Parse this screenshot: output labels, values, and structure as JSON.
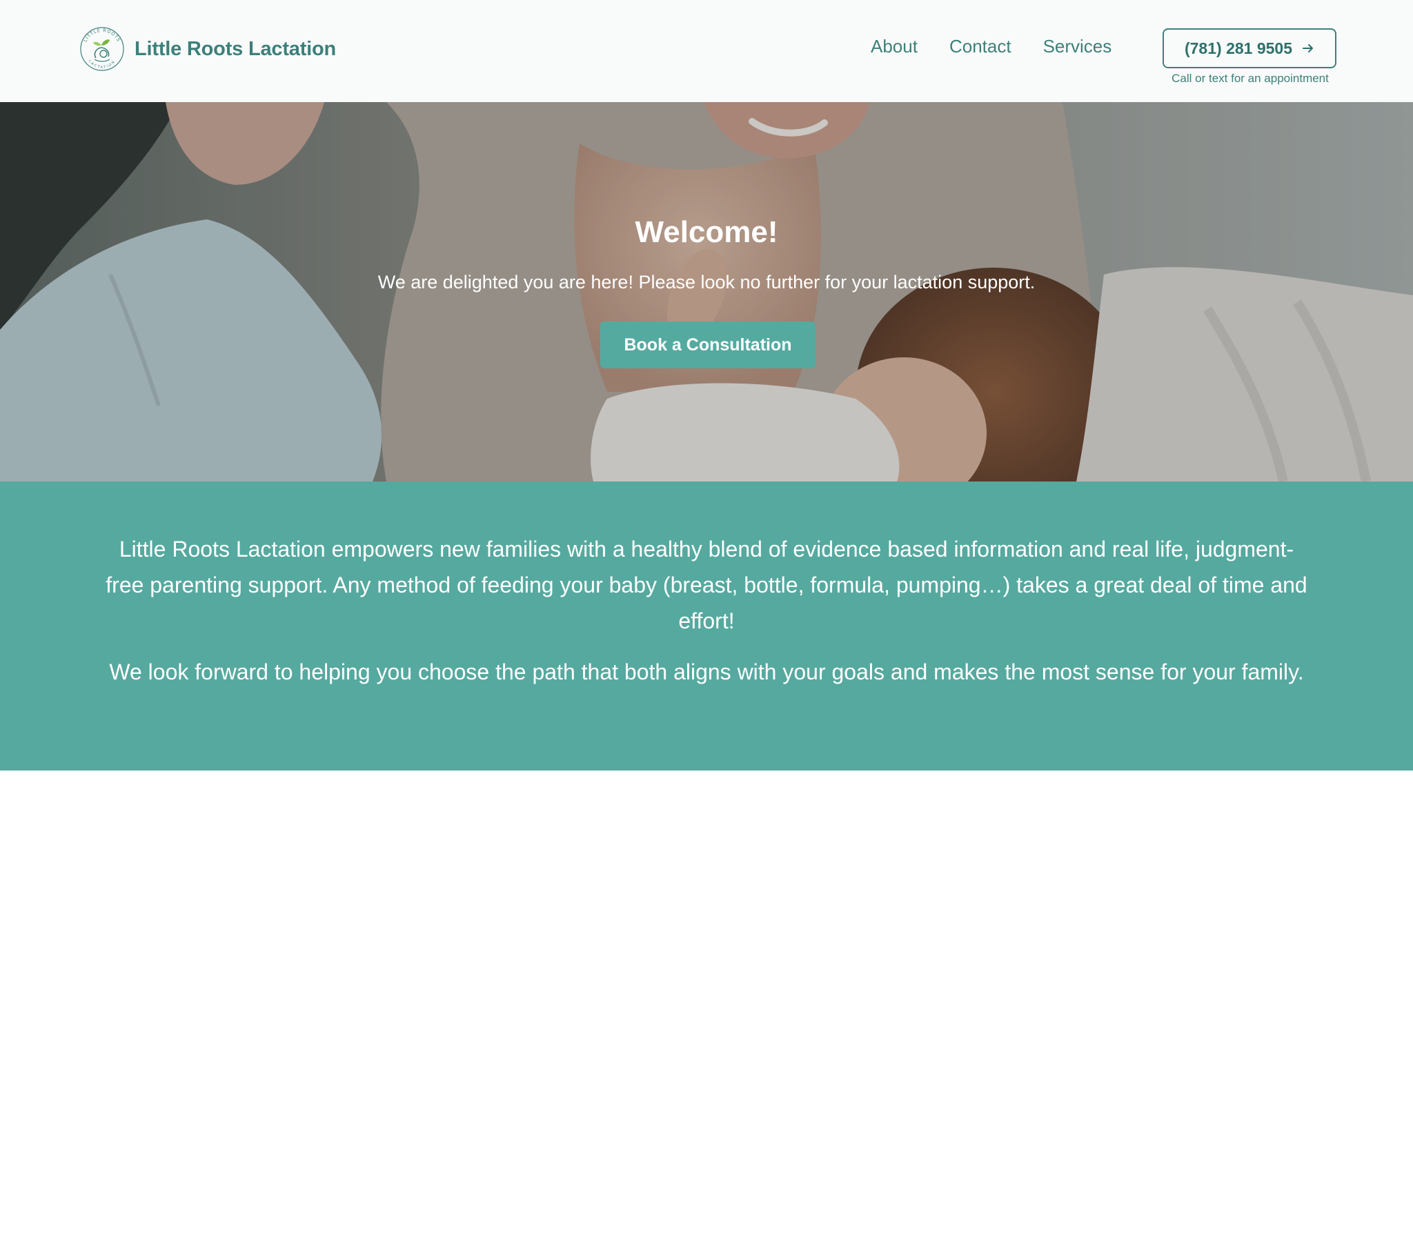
{
  "brand": {
    "name": "Little Roots Lactation",
    "logo_icon": "little-roots-logo-icon",
    "logo_text": "LITTLE ROOTS LACTATION"
  },
  "nav": {
    "items": [
      {
        "label": "About"
      },
      {
        "label": "Contact"
      },
      {
        "label": "Services"
      }
    ]
  },
  "contact": {
    "phone": "(781) 281 9505",
    "phone_icon": "arrow-right-icon",
    "caption": "Call or text for an appointment"
  },
  "hero": {
    "title": "Welcome!",
    "subtitle": "We are delighted you are here! Please look no further for your lactation support.",
    "cta_label": "Book a Consultation"
  },
  "intro": {
    "paragraph_1": "Little Roots Lactation empowers new families with a healthy blend of evidence based information and real life, judgment-free parenting support. Any method of feeding your baby (breast, bottle, formula, pumping…) takes a great deal of time and effort!",
    "paragraph_2": "We look forward to helping you choose the path that both aligns with your goals and makes the most sense for your family."
  },
  "colors": {
    "brand_teal": "#3e7f7a",
    "accent_teal": "#56a99f",
    "header_bg": "#f8fbfa",
    "text_on_teal": "#ffffff"
  }
}
